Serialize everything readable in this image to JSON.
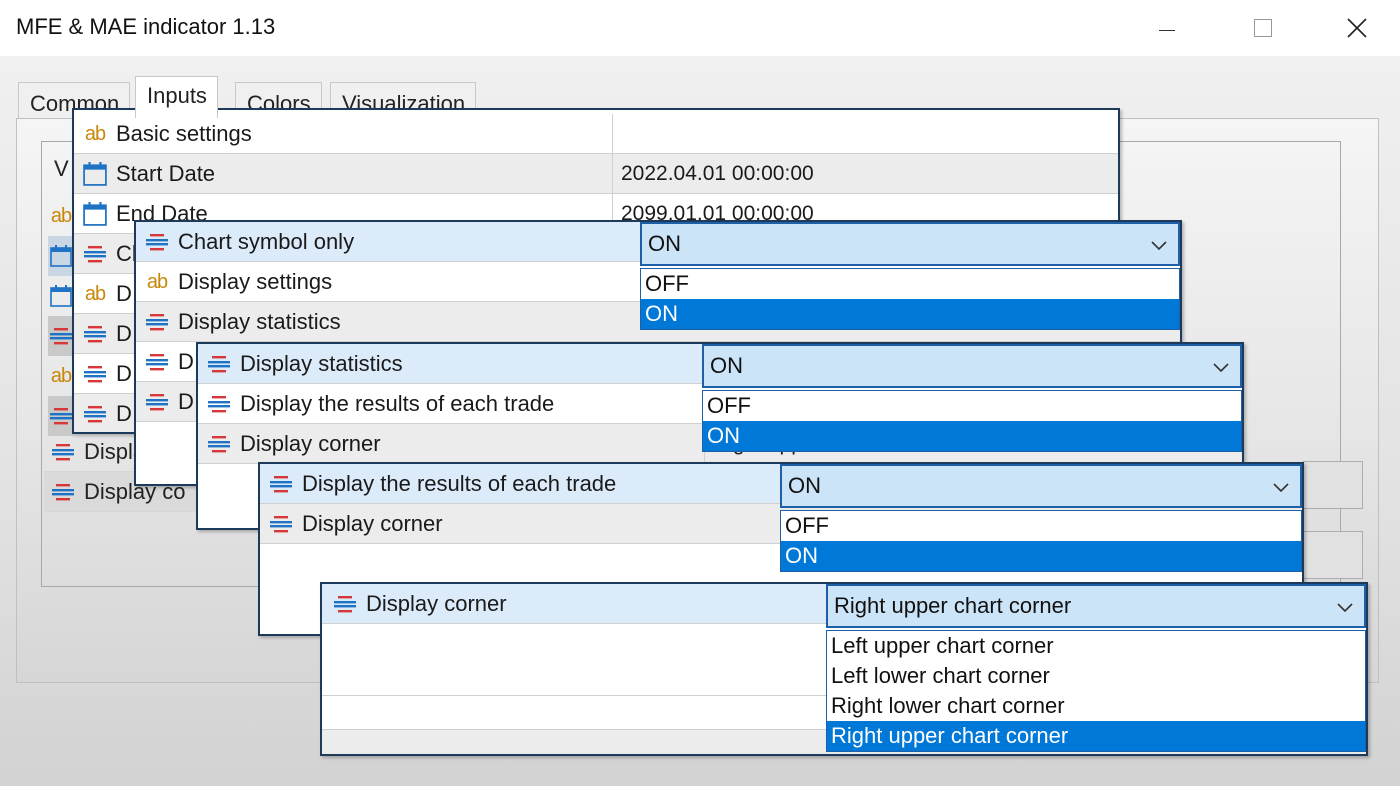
{
  "window": {
    "title": "MFE & MAE indicator 1.13"
  },
  "tabs": [
    {
      "label": "Common"
    },
    {
      "label": "Inputs"
    },
    {
      "label": "Colors"
    },
    {
      "label": "Visualization"
    }
  ],
  "background_panel": {
    "header_text": "V",
    "rows": [
      {
        "label": "Display",
        "icon": "enum-icon"
      },
      {
        "label": "Display co",
        "icon": "enum-icon"
      }
    ]
  },
  "layer1": {
    "rows": [
      {
        "icon": "ab-icon",
        "label": "Basic settings",
        "value": ""
      },
      {
        "icon": "calendar-icon",
        "label": "Start Date",
        "value": "2022.04.01 00:00:00"
      },
      {
        "icon": "calendar-icon",
        "label": "End Date",
        "value": "2099.01.01 00:00:00"
      },
      {
        "icon": "enum-icon",
        "label": "Cl"
      },
      {
        "icon": "ab-icon",
        "label": "D"
      },
      {
        "icon": "enum-icon",
        "label": "D"
      },
      {
        "icon": "enum-icon",
        "label": "D"
      },
      {
        "icon": "enum-icon",
        "label": "D"
      }
    ],
    "left_edge_icons": [
      "ab-icon",
      "calendar-icon",
      "calendar-icon",
      "enum-icon",
      "ab-icon",
      "enum-icon"
    ]
  },
  "layer2": {
    "rows": [
      {
        "icon": "enum-icon",
        "label": "Chart symbol only"
      },
      {
        "icon": "ab-icon",
        "label": "Display settings"
      },
      {
        "icon": "enum-icon",
        "label": "Display statistics"
      },
      {
        "icon": "enum-icon",
        "label": "D"
      },
      {
        "icon": "enum-icon",
        "label": "D"
      }
    ],
    "combo": {
      "value": "ON",
      "options": [
        "OFF",
        "ON"
      ],
      "highlighted": "ON"
    }
  },
  "layer3": {
    "rows": [
      {
        "icon": "enum-icon",
        "label": "Display statistics"
      },
      {
        "icon": "enum-icon",
        "label": "Display the results of each trade"
      },
      {
        "icon": "enum-icon",
        "label": "Display corner",
        "value": "Right upper"
      }
    ],
    "combo": {
      "value": "ON",
      "options": [
        "OFF",
        "ON"
      ],
      "highlighted": "ON"
    }
  },
  "layer4": {
    "rows": [
      {
        "icon": "enum-icon",
        "label": "Display the results of each trade"
      },
      {
        "icon": "enum-icon",
        "label": "Display corner"
      }
    ],
    "combo": {
      "value": "ON",
      "options": [
        "OFF",
        "ON"
      ],
      "highlighted": "ON"
    }
  },
  "layer5": {
    "rows": [
      {
        "icon": "enum-icon",
        "label": "Display corner"
      }
    ],
    "combo": {
      "value": "Right upper chart corner",
      "options": [
        "Left upper chart corner",
        "Left lower chart corner",
        "Right lower chart corner",
        "Right upper chart corner"
      ],
      "highlighted": "Right upper chart corner"
    }
  },
  "colors": {
    "accent": "#0078d7",
    "combo_bg": "#cce4f7",
    "ab_icon": "#c8870a",
    "calendar_icon": "#1f73c4",
    "enum_red": "#d6383a",
    "enum_blue": "#1f73c4"
  }
}
